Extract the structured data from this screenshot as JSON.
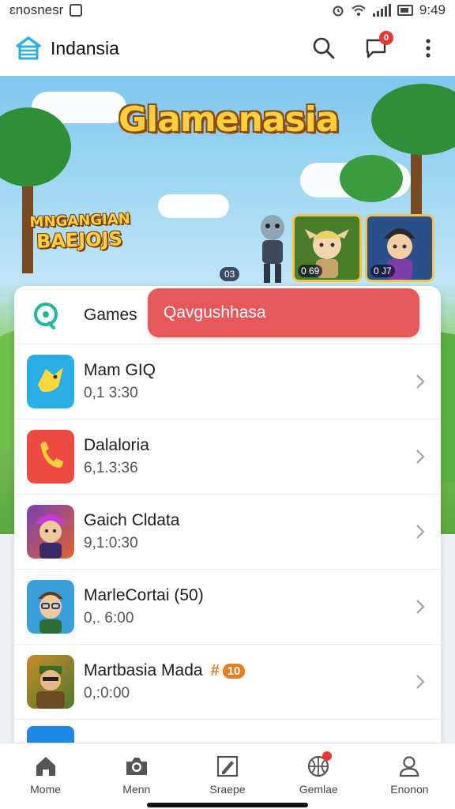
{
  "status_bar": {
    "left_text": "ɛnosnesr",
    "time": "9:49"
  },
  "app_bar": {
    "title": "Indansia",
    "notification_badge": "0",
    "icons": [
      "house-logo-icon",
      "search-icon",
      "chat-icon",
      "more-vert-icon"
    ]
  },
  "banner": {
    "title": "Glamenasia",
    "badge_line1": "MNGANGIAN",
    "badge_line2": "BAEJOJS",
    "stats": [
      "03",
      "0 69",
      "0 J7"
    ]
  },
  "list_header": {
    "label": "Games",
    "search_value": "Qavgushhasa"
  },
  "games": [
    {
      "name": "Mam GIQ",
      "meta": "0,1 3:30",
      "icon": "chat-bubble-icon",
      "color": "#29aee6"
    },
    {
      "name": "Dalaloria",
      "meta": "6,1.3:36",
      "icon": "phone-icon",
      "color": "#ec4a43"
    },
    {
      "name": "Gaich Cldata",
      "meta": "9,1:0:30",
      "icon": "hero-avatar-icon",
      "color": "#7a3fb5"
    },
    {
      "name": "MarleCortai (50)",
      "meta": "0,. 6:00",
      "icon": "nerd-avatar-icon",
      "color": "#3aa0dc"
    },
    {
      "name": "Martbasia Mada",
      "meta": "0,:0:00",
      "icon": "warrior-avatar-icon",
      "color": "#6c8e2e",
      "badge_symbol": "#",
      "badge_count": "10"
    }
  ],
  "bottom_nav": [
    {
      "label": "Mome",
      "icon": "home-icon"
    },
    {
      "label": "Menn",
      "icon": "camera-icon"
    },
    {
      "label": "Sraepe",
      "icon": "edit-icon"
    },
    {
      "label": "Gemlae",
      "icon": "basketball-icon"
    },
    {
      "label": "Enonon",
      "icon": "profile-icon"
    }
  ],
  "colors": {
    "accent": "#e7585a",
    "logo": "#29aee6",
    "header_bg": "#ffffff"
  }
}
